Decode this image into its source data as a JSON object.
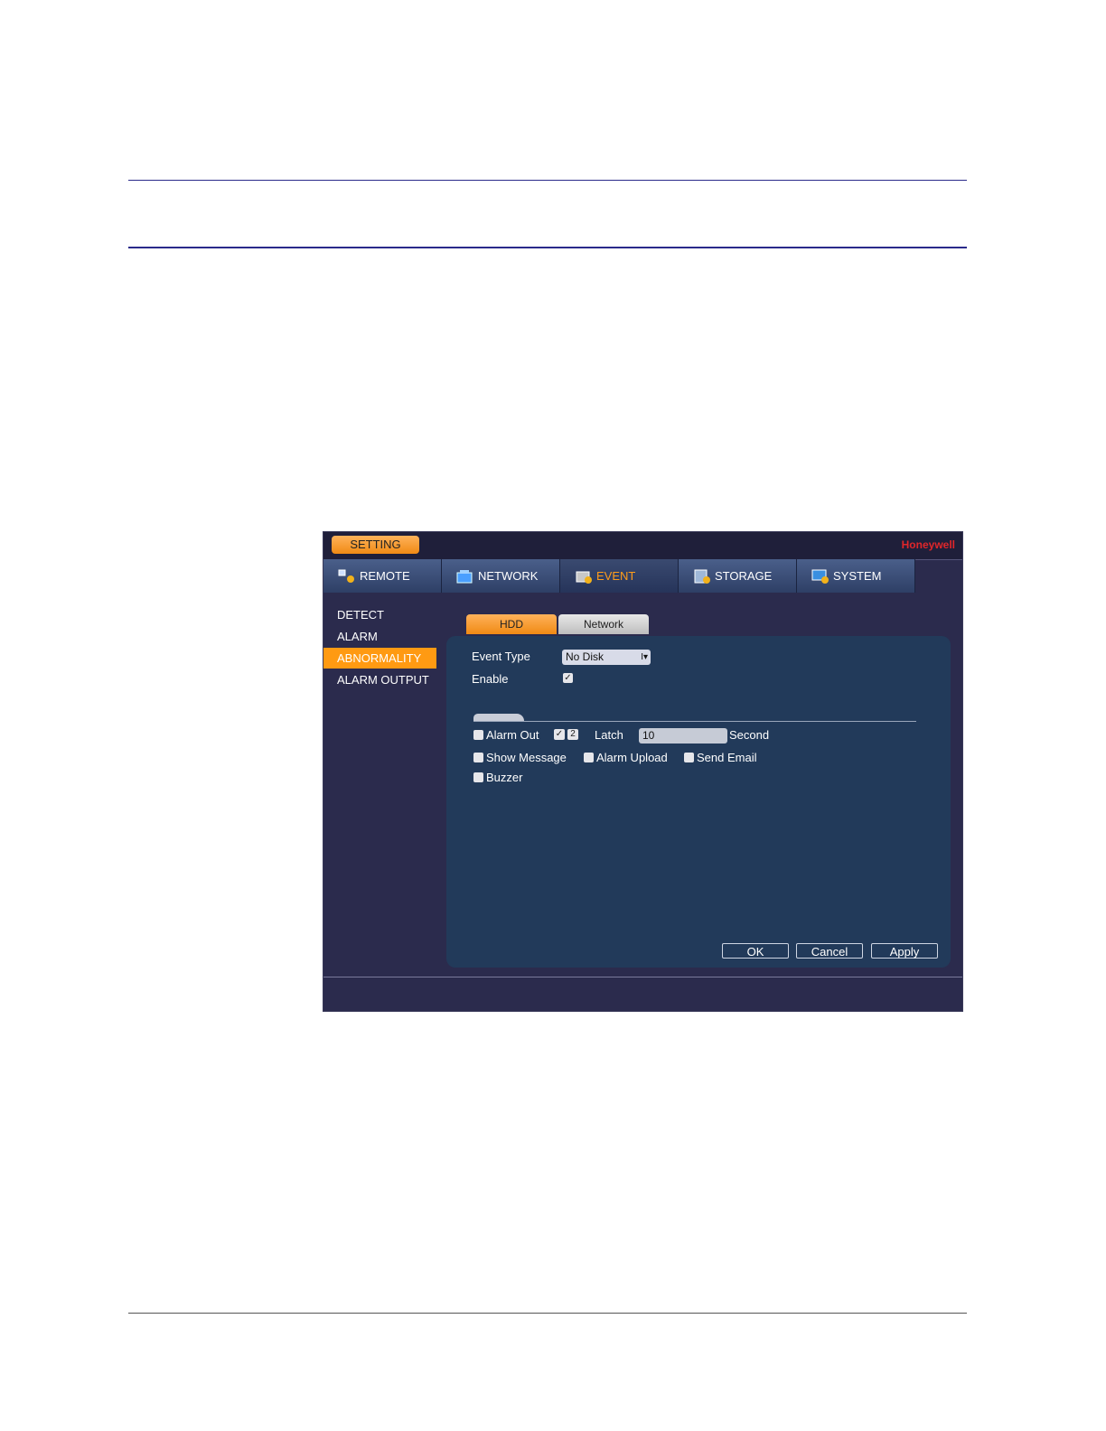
{
  "app": {
    "setting_label": "SETTING",
    "brand": "Honeywell",
    "accent_color": "#ff9a12"
  },
  "topnav": [
    {
      "label": "REMOTE",
      "icon": "remote-icon"
    },
    {
      "label": "NETWORK",
      "icon": "network-icon"
    },
    {
      "label": "EVENT",
      "icon": "event-icon",
      "active": true
    },
    {
      "label": "STORAGE",
      "icon": "storage-icon"
    },
    {
      "label": "SYSTEM",
      "icon": "system-icon"
    }
  ],
  "sidemenu": [
    {
      "label": "DETECT"
    },
    {
      "label": "ALARM"
    },
    {
      "label": "ABNORMALITY",
      "active": true
    },
    {
      "label": "ALARM OUTPUT"
    }
  ],
  "subtabs": [
    {
      "label": "HDD",
      "active": true
    },
    {
      "label": "Network"
    }
  ],
  "form": {
    "event_type_label": "Event Type",
    "event_type_value": "No Disk",
    "enable_label": "Enable",
    "enable_checked": true,
    "alarm_out_label": "Alarm Out",
    "alarm_out_checked": false,
    "alarm_channel_check": "✓",
    "alarm_channel_num": "2",
    "latch_label": "Latch",
    "latch_value": "10",
    "second_label": "Second",
    "show_message_label": "Show Message",
    "alarm_upload_label": "Alarm Upload",
    "send_email_label": "Send Email",
    "buzzer_label": "Buzzer"
  },
  "buttons": {
    "ok": "OK",
    "cancel": "Cancel",
    "apply": "Apply"
  }
}
